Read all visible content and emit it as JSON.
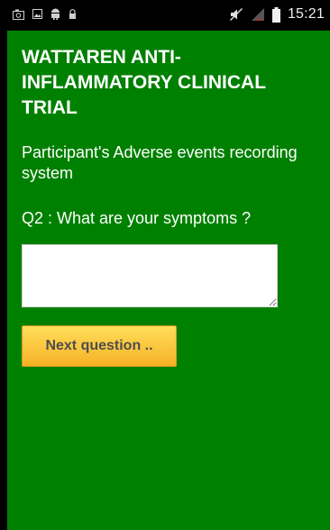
{
  "status_bar": {
    "time": "15:21",
    "left_icons": [
      "screenshot-icon",
      "gallery-icon",
      "android-debug-icon",
      "lock-icon"
    ],
    "right_icons": [
      "mute-icon",
      "signal-icon",
      "battery-icon"
    ]
  },
  "app": {
    "title": "WATTAREN ANTI-INFLAMMATORY CLINICAL TRIAL",
    "subtitle": "Participant's Adverse events recording system",
    "question": "Q2 : What are your symptoms ?",
    "answer_value": "",
    "next_button_label": "Next question ..",
    "colors": {
      "background": "#008000",
      "button": "#f6b226",
      "button_text": "#4e4e4e"
    }
  }
}
